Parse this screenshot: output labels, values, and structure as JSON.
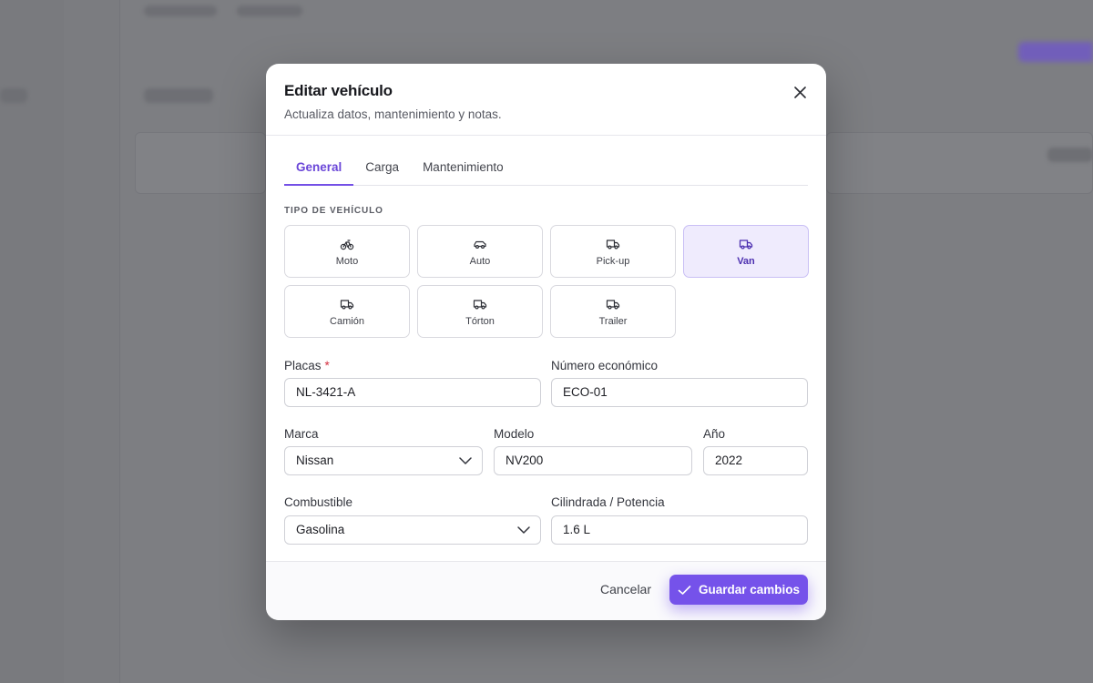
{
  "modal": {
    "title": "Editar vehículo",
    "subtitle": "Actualiza datos, mantenimiento y notas."
  },
  "tabs": [
    {
      "label": "General",
      "active": true
    },
    {
      "label": "Carga",
      "active": false
    },
    {
      "label": "Mantenimiento",
      "active": false
    }
  ],
  "vehicle_type": {
    "section_label": "TIPO DE VEHÍCULO",
    "options": [
      {
        "label": "Moto",
        "icon": "bicycle-icon",
        "selected": false
      },
      {
        "label": "Auto",
        "icon": "car-icon",
        "selected": false
      },
      {
        "label": "Pick-up",
        "icon": "truck-icon",
        "selected": false
      },
      {
        "label": "Van",
        "icon": "truck-icon",
        "selected": true
      },
      {
        "label": "Camión",
        "icon": "truck-icon",
        "selected": false
      },
      {
        "label": "Tórton",
        "icon": "truck-icon",
        "selected": false
      },
      {
        "label": "Trailer",
        "icon": "truck-icon",
        "selected": false
      }
    ]
  },
  "form": {
    "placas": {
      "label": "Placas",
      "required_mark": "*",
      "value": "NL-3421-A"
    },
    "numero_economico": {
      "label": "Número económico",
      "value": "ECO-01"
    },
    "marca": {
      "label": "Marca",
      "value": "Nissan"
    },
    "modelo": {
      "label": "Modelo",
      "value": "NV200"
    },
    "anio": {
      "label": "Año",
      "value": "2022"
    },
    "combustible": {
      "label": "Combustible",
      "value": "Gasolina"
    },
    "cilindrada": {
      "label": "Cilindrada / Potencia",
      "value": "1.6 L"
    }
  },
  "footer": {
    "cancel_label": "Cancelar",
    "save_label": "Guardar cambios"
  },
  "colors": {
    "accent": "#7552ea",
    "selected_bg": "#efebfd",
    "required": "#d43040"
  }
}
